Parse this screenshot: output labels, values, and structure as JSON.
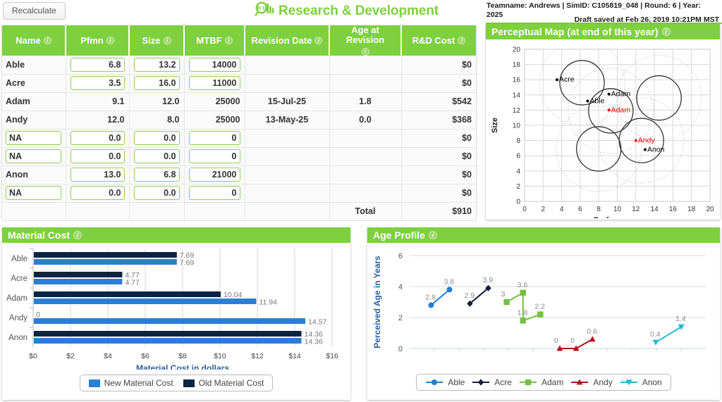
{
  "header": {
    "recalculate_label": "Recalculate",
    "title": "Research & Development",
    "logo_icon": "rd-magnifier-bar-icon",
    "team_info": "Teamname: Andrews | SimID: C105819_048 | Round: 6 | Year: 2025",
    "draft_saved": "Draft saved at Feb 26, 2019 10:21PM MST",
    "brand_green": "#7ed03f"
  },
  "rd_table": {
    "columns": [
      {
        "label": "Name",
        "info": "i"
      },
      {
        "label": "Pfmn",
        "info": "i"
      },
      {
        "label": "Size",
        "info": "i"
      },
      {
        "label": "MTBF",
        "info": "i"
      },
      {
        "label": "Revision Date",
        "info": "i"
      },
      {
        "label": "Age at Revision",
        "info": "i"
      },
      {
        "label": "R&D Cost",
        "info": "i"
      }
    ],
    "rows": [
      {
        "name": "Able",
        "name_editable": false,
        "pfmn": "6.8",
        "size": "13.2",
        "mtbf": "14000",
        "editable": true,
        "revision_date": "",
        "age_at_revision": "",
        "rd_cost": "$0"
      },
      {
        "name": "Acre",
        "name_editable": false,
        "pfmn": "3.5",
        "size": "16.0",
        "mtbf": "11000",
        "editable": true,
        "revision_date": "",
        "age_at_revision": "",
        "rd_cost": "$0"
      },
      {
        "name": "Adam",
        "name_editable": false,
        "pfmn": "9.1",
        "size": "12.0",
        "mtbf": "25000",
        "editable": false,
        "revision_date": "15-Jul-25",
        "age_at_revision": "1.8",
        "rd_cost": "$542"
      },
      {
        "name": "Andy",
        "name_editable": false,
        "pfmn": "12.0",
        "size": "8.0",
        "mtbf": "25000",
        "editable": false,
        "revision_date": "13-May-25",
        "age_at_revision": "0.0",
        "rd_cost": "$368"
      },
      {
        "name": "NA",
        "name_editable": true,
        "pfmn": "0.0",
        "size": "0.0",
        "mtbf": "0",
        "editable": true,
        "revision_date": "",
        "age_at_revision": "",
        "rd_cost": "$0"
      },
      {
        "name": "NA",
        "name_editable": true,
        "pfmn": "0.0",
        "size": "0.0",
        "mtbf": "0",
        "editable": true,
        "revision_date": "",
        "age_at_revision": "",
        "rd_cost": "$0"
      },
      {
        "name": "Anon",
        "name_editable": false,
        "pfmn": "13.0",
        "size": "6.8",
        "mtbf": "21000",
        "editable": true,
        "revision_date": "",
        "age_at_revision": "",
        "rd_cost": "$0"
      },
      {
        "name": "NA",
        "name_editable": true,
        "pfmn": "0.0",
        "size": "0.0",
        "mtbf": "0",
        "editable": true,
        "revision_date": "",
        "age_at_revision": "",
        "rd_cost": "$0"
      }
    ],
    "total_label": "Total",
    "total_value": "$910"
  },
  "perceptual_map": {
    "title": "Perceptual Map (at end of this year)",
    "info": "i"
  },
  "material_cost": {
    "title": "Material Cost",
    "info": "i"
  },
  "age_profile": {
    "title": "Age Profile",
    "info": "i"
  },
  "chart_data": [
    {
      "id": "perceptual-map",
      "type": "scatter",
      "title": "Perceptual Map (at end of this year)",
      "xlabel": "Performance",
      "ylabel": "Size",
      "xlim": [
        0,
        20
      ],
      "ylim": [
        0,
        20
      ],
      "xticks": [
        0,
        2,
        4,
        6,
        8,
        10,
        12,
        14,
        16,
        18,
        20
      ],
      "yticks": [
        0,
        2,
        4,
        6,
        8,
        10,
        12,
        14,
        16,
        18,
        20
      ],
      "grid": true,
      "points": [
        {
          "label": "Acre",
          "x": 3.5,
          "y": 16.0,
          "color": "#000000"
        },
        {
          "label": "Able",
          "x": 6.8,
          "y": 13.2,
          "color": "#000000"
        },
        {
          "label": "Adam",
          "x": 9.1,
          "y": 14.1,
          "color": "#000000"
        },
        {
          "label": "Adam",
          "x": 9.1,
          "y": 12.0,
          "color": "#ff0000"
        },
        {
          "label": "Andy",
          "x": 12.0,
          "y": 8.0,
          "color": "#ff0000"
        },
        {
          "label": "Anon",
          "x": 13.0,
          "y": 6.8,
          "color": "#000000"
        }
      ],
      "segment_circles": [
        {
          "cx": 6.2,
          "cy": 15.6,
          "r": 2.4
        },
        {
          "cx": 9.3,
          "cy": 11.9,
          "r": 2.4
        },
        {
          "cx": 14.5,
          "cy": 13.6,
          "r": 2.4
        },
        {
          "cx": 8.0,
          "cy": 6.9,
          "r": 2.4
        },
        {
          "cx": 12.6,
          "cy": 8.0,
          "r": 2.4
        }
      ],
      "dotted_circles": [
        {
          "cx": 6.2,
          "cy": 15.6,
          "r": 4.6
        },
        {
          "cx": 9.3,
          "cy": 11.9,
          "r": 4.6
        },
        {
          "cx": 14.5,
          "cy": 13.6,
          "r": 4.6
        },
        {
          "cx": 8.0,
          "cy": 6.9,
          "r": 4.6
        },
        {
          "cx": 12.6,
          "cy": 8.0,
          "r": 4.6
        }
      ]
    },
    {
      "id": "material-cost",
      "type": "bar",
      "orientation": "horizontal",
      "title": "Material Cost",
      "xlabel": "Material Cost in dollars",
      "ylabel": "",
      "categories": [
        "Able",
        "Acre",
        "Adam",
        "Andy",
        "Anon"
      ],
      "xlim": [
        0,
        16
      ],
      "xticks": [
        "$0",
        "$2",
        "$4",
        "$6",
        "$8",
        "$10",
        "$12",
        "$14",
        "$16"
      ],
      "xtick_values": [
        0,
        2,
        4,
        6,
        8,
        10,
        12,
        14,
        16
      ],
      "grid": true,
      "legend_position": "bottom",
      "series": [
        {
          "name": "Old Material Cost",
          "color": "#0d2440",
          "values": [
            7.69,
            4.77,
            10.04,
            0,
            14.36
          ],
          "labels": [
            "7.69",
            "4.77",
            "10.04",
            "0",
            "14.36"
          ]
        },
        {
          "name": "New Material Cost",
          "color": "#2a7fd4",
          "values": [
            7.69,
            4.77,
            11.94,
            14.57,
            14.36
          ],
          "labels": [
            "7.69",
            "4.77",
            "11.94",
            "14.57",
            "14.36"
          ]
        }
      ]
    },
    {
      "id": "age-profile",
      "type": "line",
      "title": "Age Profile",
      "xlabel": "",
      "ylabel": "Perceived Age in Years",
      "ylim": [
        0,
        6
      ],
      "yticks": [
        0,
        2,
        4,
        6
      ],
      "grid": true,
      "legend_position": "bottom",
      "series": [
        {
          "name": "Able",
          "color": "#1f7fd4",
          "marker": "circle",
          "x": [
            1.05,
            1.95
          ],
          "y": [
            2.8,
            3.8
          ],
          "labels": [
            "2.8",
            "3.8"
          ]
        },
        {
          "name": "Acre",
          "color": "#10203a",
          "marker": "diamond",
          "x": [
            2.95,
            3.85
          ],
          "y": [
            2.9,
            3.9
          ],
          "labels": [
            "2.9",
            "3.9"
          ]
        },
        {
          "name": "Adam",
          "color": "#76c043",
          "marker": "square",
          "x": [
            4.75,
            5.55,
            5.55,
            6.4
          ],
          "y": [
            3.0,
            3.6,
            1.8,
            2.2
          ],
          "labels": [
            "3",
            "3.6",
            "1.8",
            "2.2"
          ]
        },
        {
          "name": "Andy",
          "color": "#b5121b",
          "marker": "triangle",
          "x": [
            7.35,
            8.15,
            8.95
          ],
          "y": [
            0,
            0,
            0.6
          ],
          "labels": [
            "0",
            "0",
            "0.6"
          ]
        },
        {
          "name": "Anon",
          "color": "#23b7d6",
          "marker": "tri-down",
          "x": [
            12.05,
            13.3
          ],
          "y": [
            0.4,
            1.4
          ],
          "labels": [
            "0.4",
            "1.4"
          ]
        }
      ]
    }
  ]
}
